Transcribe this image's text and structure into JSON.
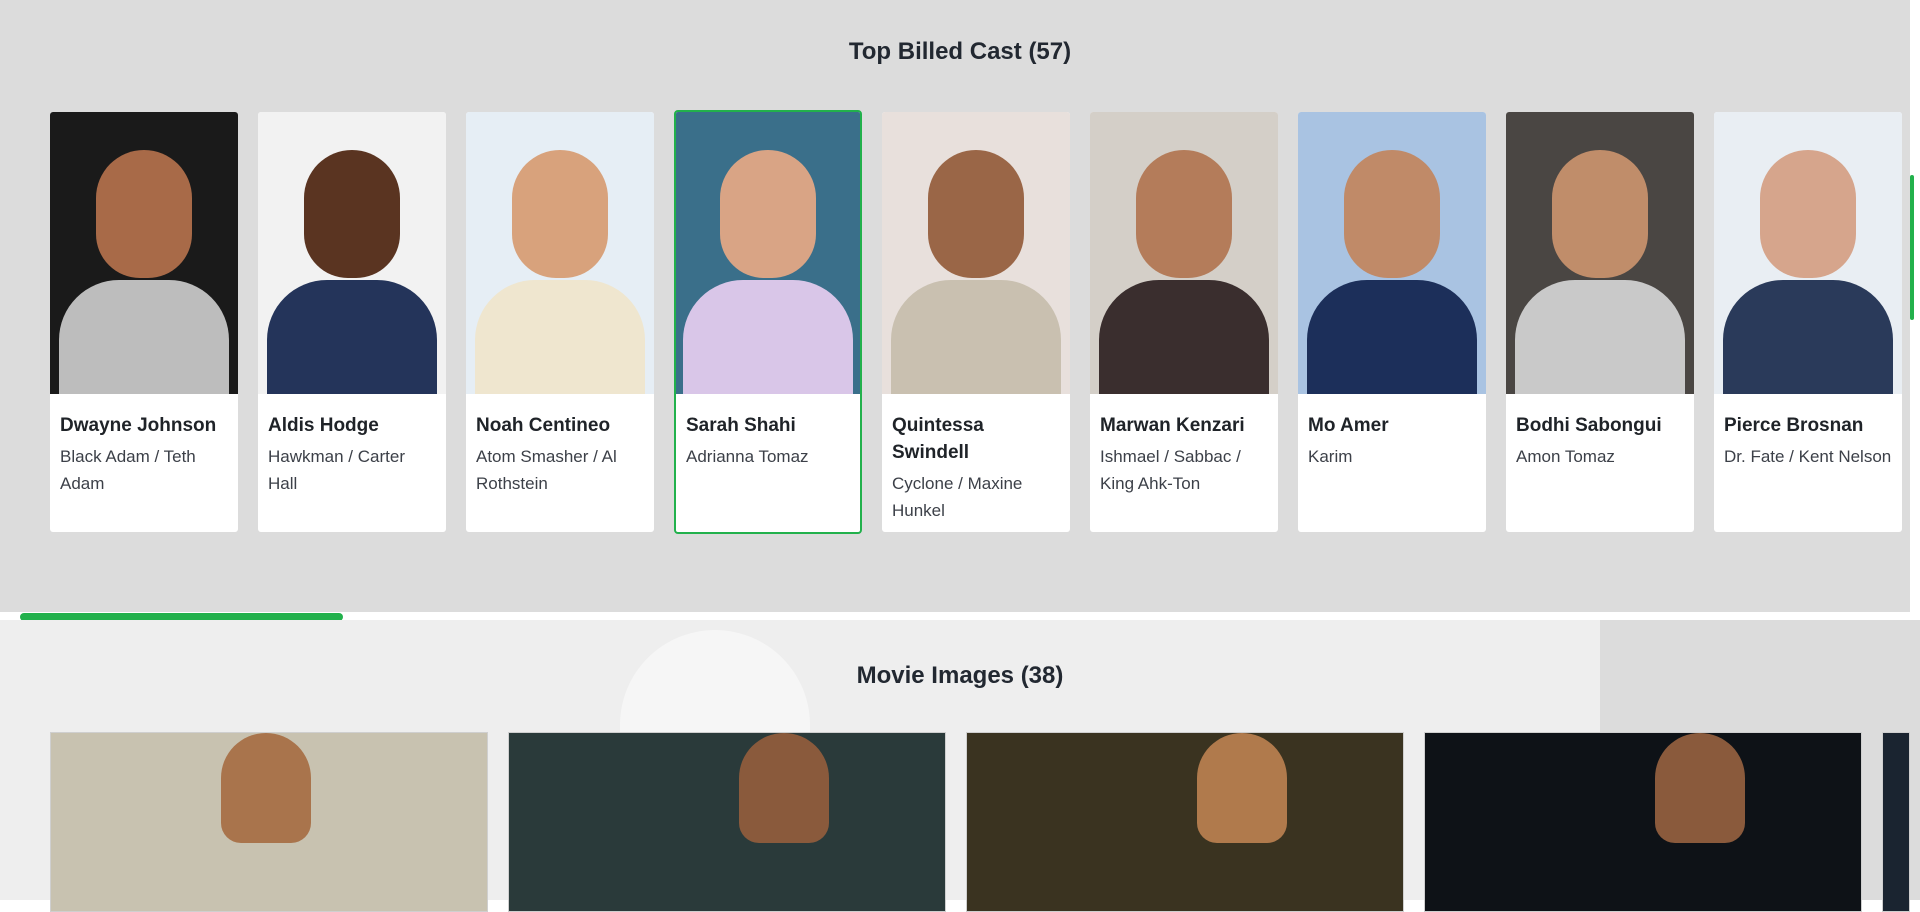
{
  "cast": {
    "title": "Top Billed Cast (57)",
    "members": [
      {
        "name": "Dwayne Johnson",
        "role": "Black Adam / Teth Adam",
        "bg": "#1a1a1a",
        "skin": "#a86a48",
        "shirt": "#bdbdbd"
      },
      {
        "name": "Aldis Hodge",
        "role": "Hawkman / Carter Hall",
        "bg": "#f2f2f2",
        "skin": "#5a3421",
        "shirt": "#24345a"
      },
      {
        "name": "Noah Centineo",
        "role": "Atom Smasher / Al Rothstein",
        "bg": "#e6eef5",
        "skin": "#d8a27c",
        "shirt": "#efe6cf"
      },
      {
        "name": "Sarah Shahi",
        "role": "Adrianna Tomaz",
        "bg": "#3a6f8a",
        "skin": "#d9a485",
        "shirt": "#d9c6e8"
      },
      {
        "name": "Quintessa Swindell",
        "role": "Cyclone / Maxine Hunkel",
        "bg": "#e8e0dc",
        "skin": "#9a6647",
        "shirt": "#c9c0b0"
      },
      {
        "name": "Marwan Kenzari",
        "role": "Ishmael / Sabbac / King Ahk-Ton",
        "bg": "#d4cfc8",
        "skin": "#b47c5a",
        "shirt": "#3a2e2e"
      },
      {
        "name": "Mo Amer",
        "role": "Karim",
        "bg": "#a9c3e2",
        "skin": "#c08a68",
        "shirt": "#1c2f5a"
      },
      {
        "name": "Bodhi Sabongui",
        "role": "Amon Tomaz",
        "bg": "#4a4643",
        "skin": "#c08d6a",
        "shirt": "#c9c9c9"
      },
      {
        "name": "Pierce Brosnan",
        "role": "Dr. Fate / Kent Nelson",
        "bg": "#e9eef3",
        "skin": "#d6a58c",
        "shirt": "#2a3a5a"
      }
    ],
    "selected_index": 3,
    "scroll_progress": 0.17
  },
  "images": {
    "title": "Movie Images (38)",
    "tiles": [
      {
        "bg": "#c8c2b0",
        "accent": "#a9744c"
      },
      {
        "bg": "#2a3a3a",
        "accent": "#8a5a3c"
      },
      {
        "bg": "#3a3320",
        "accent": "#b07a4c"
      },
      {
        "bg": "#0e1217",
        "accent": "#8a5a3c"
      }
    ]
  },
  "colors": {
    "accent": "#22b14c"
  }
}
